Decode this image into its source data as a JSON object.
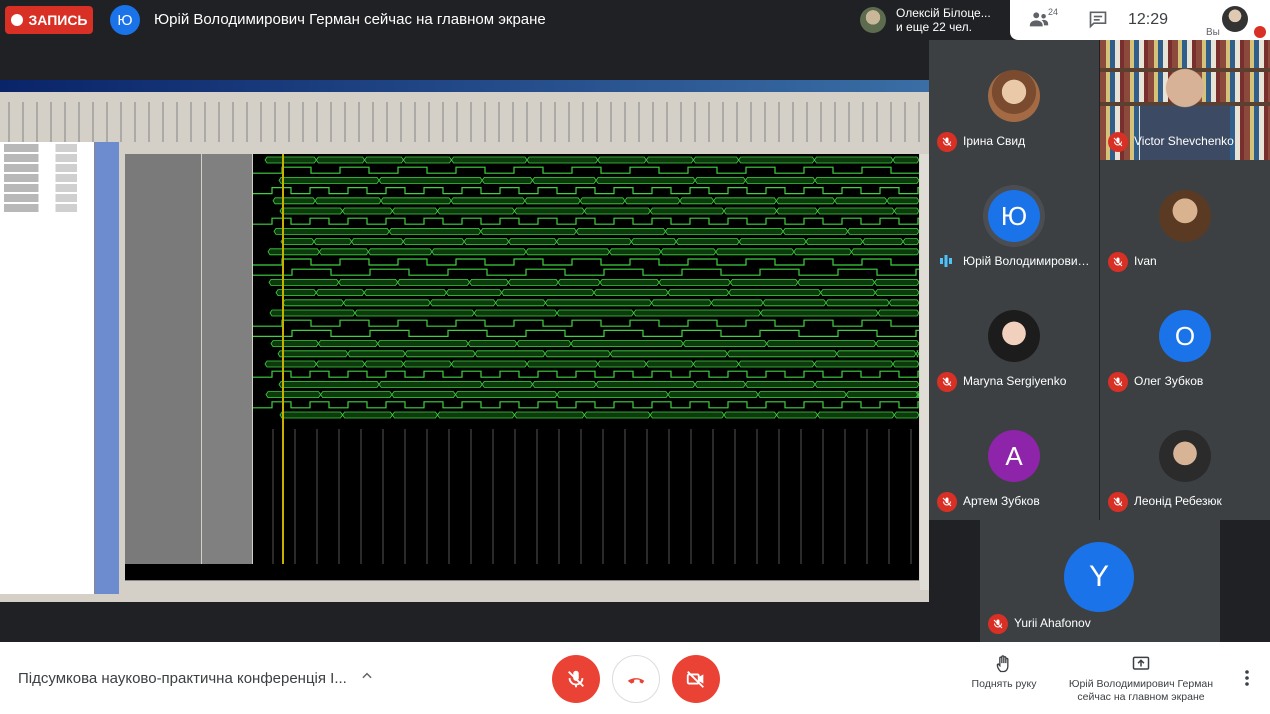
{
  "topbar": {
    "record_label": "ЗАПИСЬ",
    "presenter_initial": "Ю",
    "presenter_status": "Юрій Володимирович Герман сейчас на главном экране",
    "joiner_name": "Олексій Білоце...",
    "joiner_more": "и еще 22 чел.",
    "participants_count": "24",
    "time": "12:29",
    "self_label": "Вы"
  },
  "colors": {
    "danger": "#ea4335",
    "avatar_blue": "#1a73e8",
    "avatar_purple": "#8e24aa",
    "tile_bg": "#3c4043",
    "bg": "#202124"
  },
  "participants": [
    {
      "name": "Ірина Свид",
      "initial": "",
      "muted": true
    },
    {
      "name": "Victor Shevchenko",
      "initial": "",
      "muted": true
    },
    {
      "name": "Юрій Володимирович ...",
      "initial": "Ю",
      "muted": false,
      "speaking": true
    },
    {
      "name": "Ivan",
      "initial": "",
      "muted": true
    },
    {
      "name": "Maryna Sergiyenko",
      "initial": "",
      "muted": true
    },
    {
      "name": "Олег Зубков",
      "initial": "О",
      "muted": true
    },
    {
      "name": "Артем Зубков",
      "initial": "А",
      "muted": true
    },
    {
      "name": "Леонід Ребезюк",
      "initial": "",
      "muted": true
    },
    {
      "name": "Yurii Ahafonov",
      "initial": "Y",
      "muted": true
    }
  ],
  "bottombar": {
    "meeting_title": "Підсумкова науково-практична конференція І...",
    "raise_hand": "Поднять руку",
    "presenting_line1": "Юрій Володимирович Герман",
    "presenting_line2": "сейчас на главном экране"
  },
  "icons": {
    "mic_off": "mic-off-icon",
    "hangup": "phone-hangup-icon",
    "cam_off": "camera-off-icon",
    "hand": "hand-icon",
    "present": "present-screen-icon",
    "more": "more-vert-icon",
    "chat": "chat-icon",
    "people": "people-icon"
  }
}
